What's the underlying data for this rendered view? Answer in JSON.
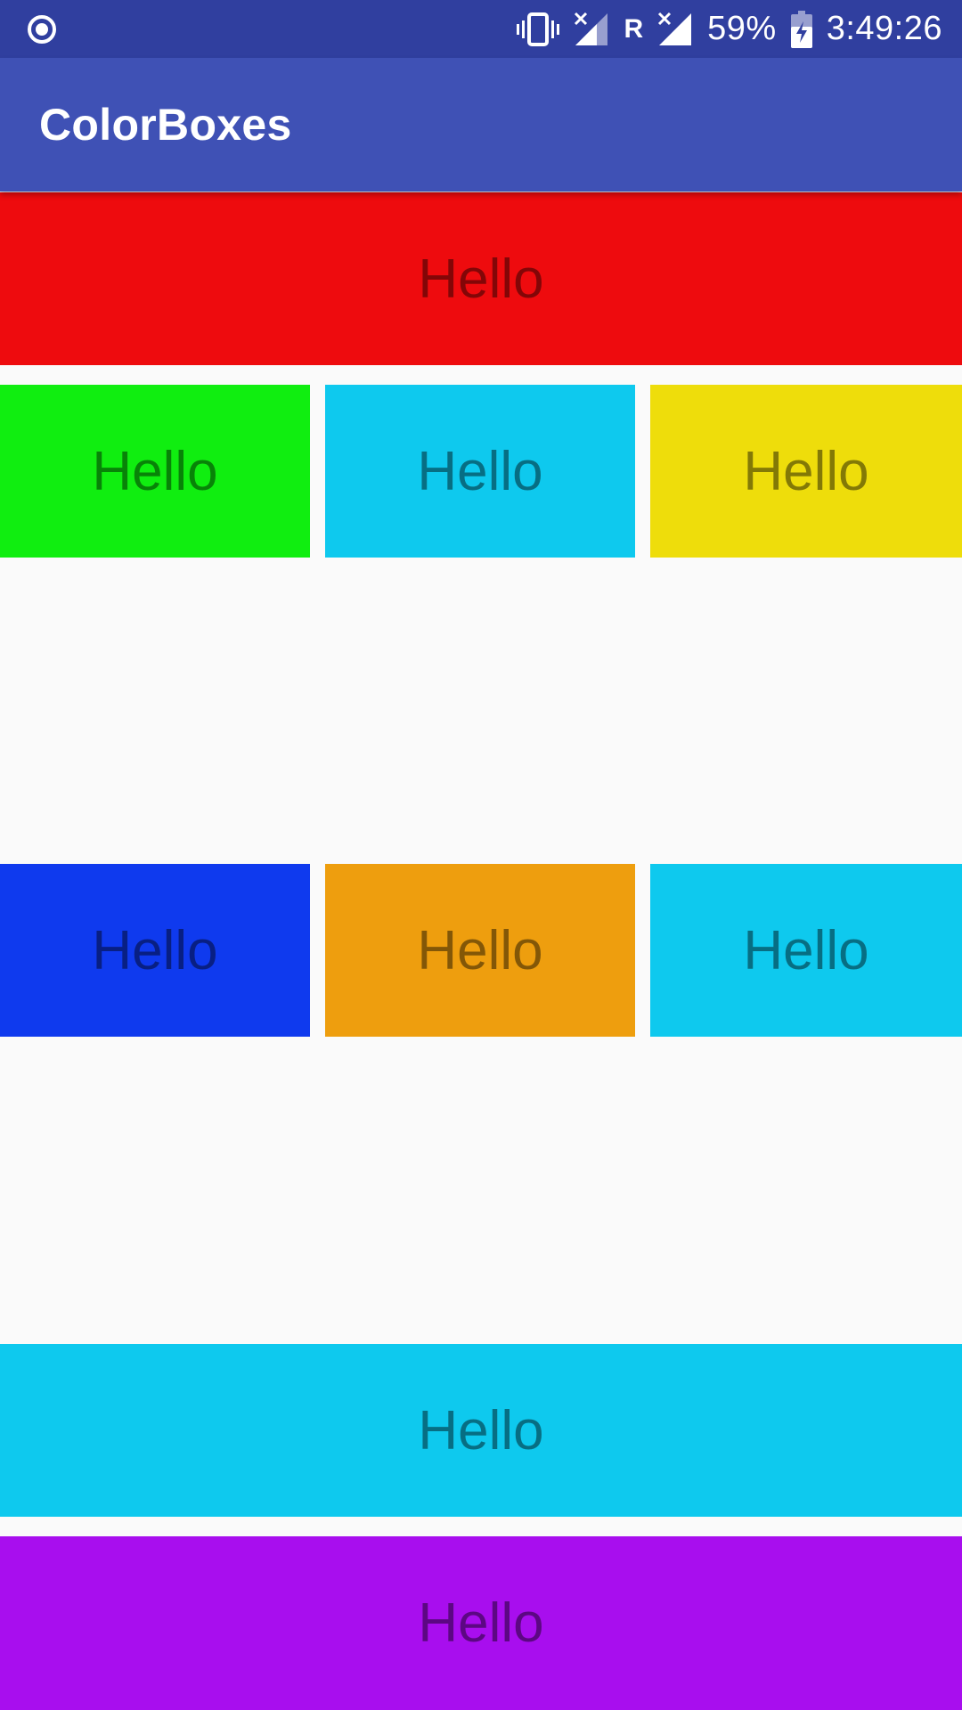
{
  "status_bar": {
    "battery": "59%",
    "time": "3:49:26",
    "roaming": "R",
    "icons": [
      "record-icon",
      "vibrate-icon",
      "signal-no-sim-icon",
      "signal-icon",
      "battery-charging-icon"
    ]
  },
  "app_bar": {
    "title": "ColorBoxes"
  },
  "boxes": [
    {
      "label": "Hello",
      "color": "#ee0b0e"
    },
    {
      "label": "Hello",
      "color": "#10ee10"
    },
    {
      "label": "Hello",
      "color": "#0ec9ee"
    },
    {
      "label": "Hello",
      "color": "#eedd0b"
    },
    {
      "label": "Hello",
      "color": "#0f3aee"
    },
    {
      "label": "Hello",
      "color": "#ee9e0e"
    },
    {
      "label": "Hello",
      "color": "#0ec9ee"
    },
    {
      "label": "Hello",
      "color": "#0ec9ee"
    },
    {
      "label": "Hello",
      "color": "#a80eee"
    }
  ],
  "colors": {
    "status_bar": "#303f9f",
    "app_bar": "#3f51b5",
    "background": "#fafafa"
  }
}
